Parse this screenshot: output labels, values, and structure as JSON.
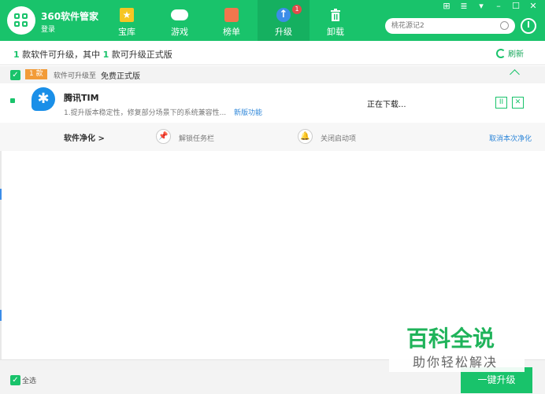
{
  "app": {
    "brand": "360软件管家",
    "login": "登录",
    "accent_color": "#19c36b"
  },
  "nav": [
    {
      "label": "宝库",
      "icon": "star-icon",
      "icon_glyph": "★"
    },
    {
      "label": "游戏",
      "icon": "gamepad-icon",
      "icon_glyph": ""
    },
    {
      "label": "榜单",
      "icon": "ranking-icon",
      "icon_glyph": ""
    },
    {
      "label": "升级",
      "icon": "upgrade-arrow-icon",
      "icon_glyph": "↑",
      "badge": "1",
      "active": true
    },
    {
      "label": "卸载",
      "icon": "trash-icon",
      "icon_glyph": "🗑"
    }
  ],
  "window_controls": {
    "skin": "⊞",
    "menu": "≣",
    "dropdown": "▾",
    "minimize": "–",
    "maximize": "☐",
    "close": "✕"
  },
  "search": {
    "placeholder": "桃花源记2"
  },
  "summary": {
    "part1_count": "1",
    "part1_text": " 款软件可升级，其中 ",
    "part2_count": "1",
    "part2_text": " 款可升级正式版",
    "refresh_label": "刷新"
  },
  "group": {
    "checkbox": "✓",
    "count_badge": "1 款",
    "note": "软件可升级至",
    "type": "免费正式版"
  },
  "app_item": {
    "name": "腾讯TIM",
    "description": "1.提升版本稳定性，修复部分场景下的系统兼容性...",
    "link": "新版功能",
    "status": "正在下载...",
    "pause_glyph": "II",
    "cancel_glyph": "✕",
    "icon_glyph": "✱"
  },
  "clean": {
    "title": "软件净化",
    "arrow": ">",
    "item1_label": "解锁任务栏",
    "item1_glyph": "📌",
    "item2_label": "关闭启动项",
    "item2_glyph": "🔔",
    "cancel_link": "取消本次净化"
  },
  "footer": {
    "select_all": "全选",
    "checkbox": "✓",
    "upgrade_button": "一键升级"
  },
  "watermark": {
    "title": "百科全说",
    "subtitle": "助你轻松解决"
  }
}
